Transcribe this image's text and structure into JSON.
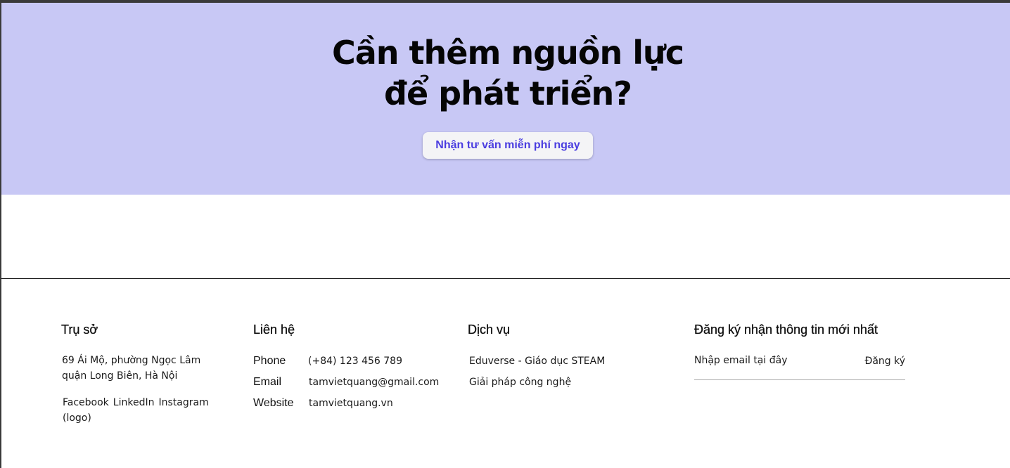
{
  "hero": {
    "title_line1": "Cần thêm nguồn lực",
    "title_line2": "để phát triển?",
    "cta_label": "Nhận tư vấn miễn phí ngay"
  },
  "footer": {
    "headquarters": {
      "heading": "Trụ sở",
      "address_line1": "69 Ái Mộ, phường Ngọc Lâm",
      "address_line2": "quận Long Biên, Hà Nội",
      "social": [
        "Facebook",
        "LinkedIn",
        "Instagram"
      ],
      "social_note": "(logo)"
    },
    "contact": {
      "heading": "Liên hệ",
      "rows": [
        {
          "label": "Phone",
          "value": "(+84) 123 456 789"
        },
        {
          "label": "Email",
          "value": "tamvietquang@gmail.com"
        },
        {
          "label": "Website",
          "value": "tamvietquang.vn"
        }
      ]
    },
    "services": {
      "heading": "Dịch vụ",
      "items": [
        "Eduverse - Giáo dục STEAM",
        "Giải pháp công nghệ"
      ]
    },
    "newsletter": {
      "heading": "Đăng ký nhận thông tin mới nhất",
      "placeholder": "Nhập email tại đây",
      "submit_label": "Đăng ký"
    }
  },
  "colors": {
    "hero_background": "#c8c8f5",
    "cta_text": "#4a3de0",
    "cta_background": "#f4f4f6"
  }
}
